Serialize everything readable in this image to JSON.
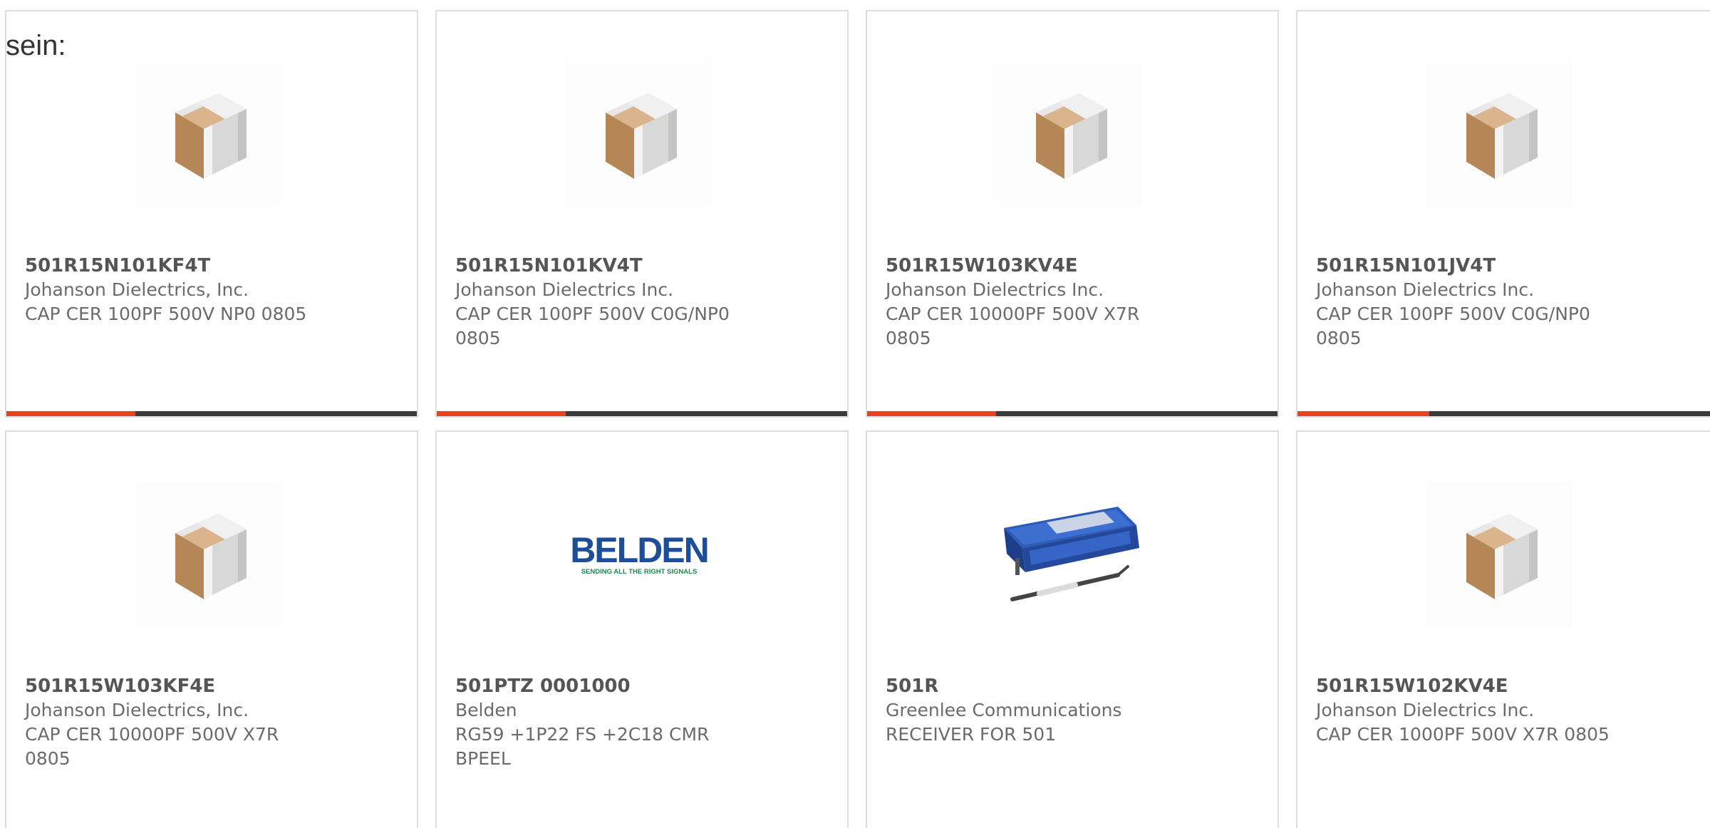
{
  "intro_text": "sein:",
  "colors": {
    "accent": "#e5441f",
    "bar_track": "#3b3b3b",
    "card_border": "#dddddd",
    "text": "#6b6b6b"
  },
  "products": [
    {
      "part_number": "501R15N101KF4T",
      "manufacturer": "Johanson Dielectrics, Inc.",
      "description": "CAP CER 100PF 500V NP0 0805",
      "image": "capacitor-chip-icon",
      "progress": 0.315
    },
    {
      "part_number": "501R15N101KV4T",
      "manufacturer": "Johanson Dielectrics Inc.",
      "description": "CAP CER 100PF 500V C0G/NP0 0805",
      "image": "capacitor-chip-icon",
      "progress": 0.315
    },
    {
      "part_number": "501R15W103KV4E",
      "manufacturer": "Johanson Dielectrics Inc.",
      "description": "CAP CER 10000PF 500V X7R 0805",
      "image": "capacitor-chip-icon",
      "progress": 0.315
    },
    {
      "part_number": "501R15N101JV4T",
      "manufacturer": "Johanson Dielectrics Inc.",
      "description": "CAP CER 100PF 500V C0G/NP0 0805",
      "image": "capacitor-chip-icon",
      "progress": 0.315
    },
    {
      "part_number": "501R15W103KF4E",
      "manufacturer": "Johanson Dielectrics, Inc.",
      "description": "CAP CER 10000PF 500V X7R 0805",
      "image": "capacitor-chip-icon"
    },
    {
      "part_number": "501PTZ 0001000",
      "manufacturer": "Belden",
      "description": "RG59 +1P22 FS +2C18 CMR BPEEL",
      "image": "belden-logo",
      "logo_text": "BELDEN",
      "logo_tagline": "SENDING ALL THE RIGHT SIGNALS"
    },
    {
      "part_number": "501R",
      "manufacturer": "Greenlee Communications",
      "description": "RECEIVER FOR 501",
      "image": "receiver-kit-case-icon"
    },
    {
      "part_number": "501R15W102KV4E",
      "manufacturer": "Johanson Dielectrics Inc.",
      "description": "CAP CER 1000PF 500V X7R 0805",
      "image": "capacitor-chip-icon"
    }
  ]
}
